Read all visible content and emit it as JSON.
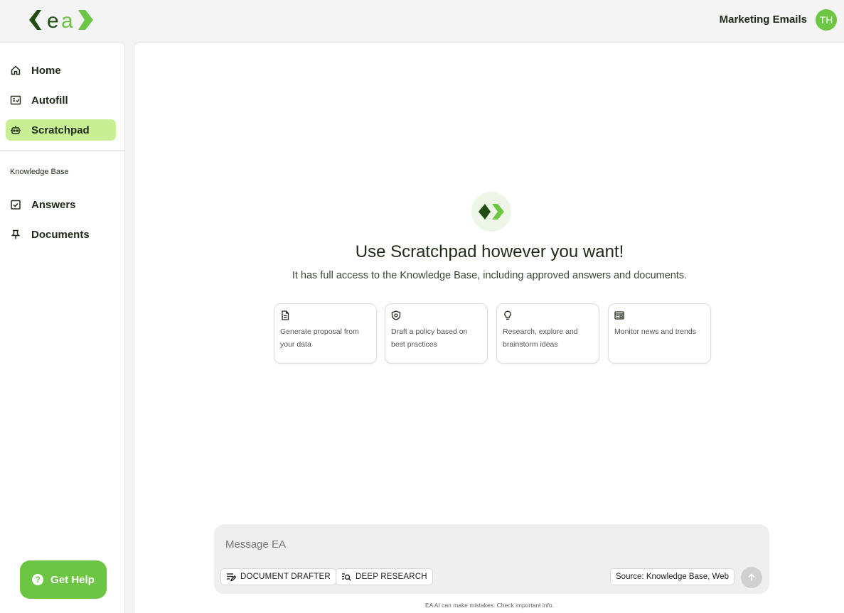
{
  "header": {
    "logo_text": "ea",
    "workspace_name": "Marketing Emails",
    "avatar_initials": "TH"
  },
  "sidebar": {
    "items": [
      {
        "label": "Home",
        "icon": "home-icon"
      },
      {
        "label": "Autofill",
        "icon": "form-icon"
      },
      {
        "label": "Scratchpad",
        "icon": "robot-icon",
        "active": true
      }
    ],
    "section_label": "Knowledge Base",
    "kb_items": [
      {
        "label": "Answers",
        "icon": "checkbox-icon"
      },
      {
        "label": "Documents",
        "icon": "pin-icon"
      }
    ],
    "help_label": "Get Help"
  },
  "main": {
    "title": "Use Scratchpad however you want!",
    "subtitle": "It has full access to the Knowledge Base, including approved answers and documents.",
    "cards": [
      {
        "text": "Generate proposal from your data",
        "icon": "document-icon"
      },
      {
        "text": "Draft a policy based on best practices",
        "icon": "shield-icon"
      },
      {
        "text": "Research, explore and brainstorm ideas",
        "icon": "lightbulb-icon"
      },
      {
        "text": "Monitor news and trends",
        "icon": "newspaper-icon"
      }
    ]
  },
  "composer": {
    "placeholder": "Message EA",
    "chips": {
      "document_drafter": "DOCUMENT DRAFTER",
      "deep_research": "DEEP RESEARCH",
      "source": "Source: Knowledge Base, Web"
    },
    "disclaimer": "EA AI can make mistakes. Check important info."
  },
  "colors": {
    "brand_green": "#6cc644",
    "dark_green": "#1f4d12",
    "active_nav": "#c9ef94"
  }
}
